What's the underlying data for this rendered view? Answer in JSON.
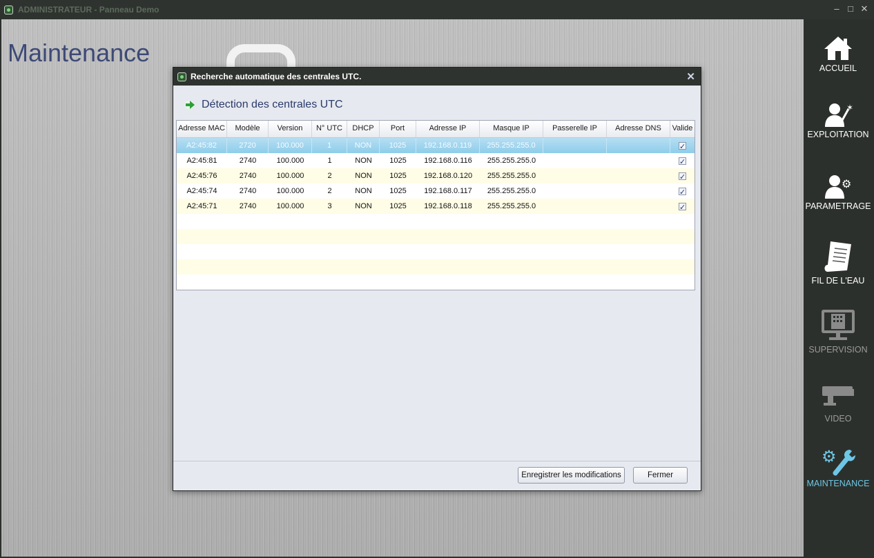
{
  "app": {
    "title": "ADMINISTRATEUR - Panneau Demo",
    "minimize": "–",
    "maximize": "□",
    "close": "✕"
  },
  "page": {
    "title": "Maintenance"
  },
  "sidebar": {
    "items": [
      {
        "label": "ACCUEIL",
        "icon": "home-icon",
        "state": "normal"
      },
      {
        "label": "EXPLOITATION",
        "icon": "operator-wand-icon",
        "state": "normal"
      },
      {
        "label": "PARAMETRAGE",
        "icon": "user-gear-icon",
        "state": "normal"
      },
      {
        "label": "FIL DE L'EAU",
        "icon": "document-list-icon",
        "state": "normal"
      },
      {
        "label": "SUPERVISION",
        "icon": "monitor-building-icon",
        "state": "disabled"
      },
      {
        "label": "VIDEO",
        "icon": "camera-icon",
        "state": "disabled"
      },
      {
        "label": "MAINTENANCE",
        "icon": "gear-wrench-icon",
        "state": "active"
      }
    ]
  },
  "dialog": {
    "title": "Recherche automatique des centrales UTC.",
    "close": "✕",
    "section_title": "Détection des centrales UTC",
    "columns": [
      "Adresse MAC",
      "Modèle",
      "Version",
      "N° UTC",
      "DHCP",
      "Port",
      "Adresse IP",
      "Masque IP",
      "Passerelle IP",
      "Adresse DNS",
      "Valide"
    ],
    "rows": [
      [
        "A2:45:82",
        "2720",
        "100.000",
        "1",
        "NON",
        "1025",
        "192.168.0.119",
        "255.255.255.0",
        "",
        "",
        true
      ],
      [
        "A2:45:81",
        "2740",
        "100.000",
        "1",
        "NON",
        "1025",
        "192.168.0.116",
        "255.255.255.0",
        "",
        "",
        true
      ],
      [
        "A2:45:76",
        "2740",
        "100.000",
        "2",
        "NON",
        "1025",
        "192.168.0.120",
        "255.255.255.0",
        "",
        "",
        true
      ],
      [
        "A2:45:74",
        "2740",
        "100.000",
        "2",
        "NON",
        "1025",
        "192.168.0.117",
        "255.255.255.0",
        "",
        "",
        true
      ],
      [
        "A2:45:71",
        "2740",
        "100.000",
        "3",
        "NON",
        "1025",
        "192.168.0.118",
        "255.255.255.0",
        "",
        "",
        true
      ]
    ],
    "selected_row": 0,
    "buttons": {
      "save": "Enregistrer les modifications",
      "close": "Fermer"
    }
  },
  "colors": {
    "accent_active": "#6ec6e6",
    "title_blue": "#3d4a76",
    "selection": "#8ecdea",
    "alt_row": "#fffde6"
  }
}
